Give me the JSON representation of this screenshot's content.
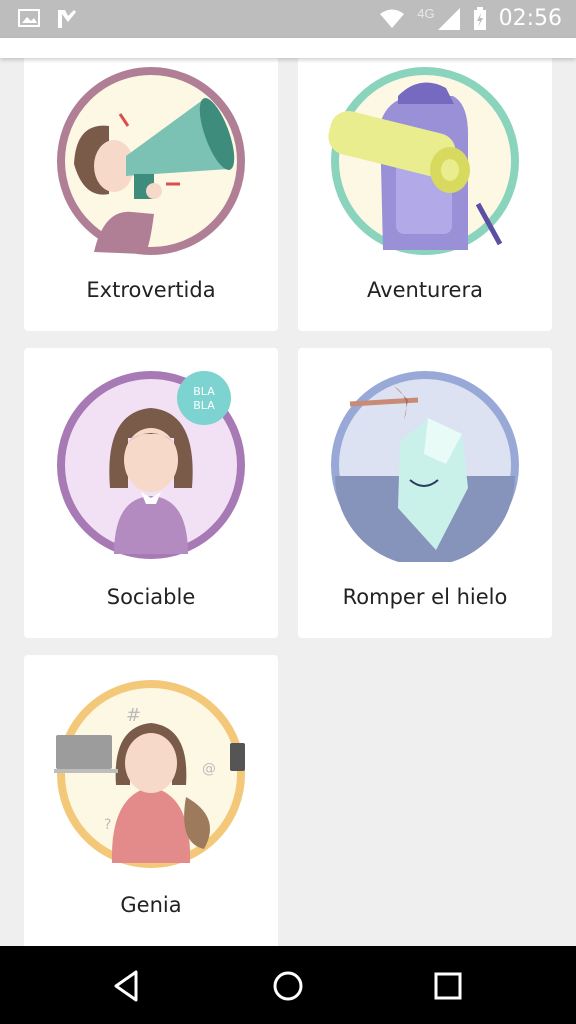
{
  "status_bar": {
    "network": "4G",
    "time": "02:56"
  },
  "badges": [
    {
      "label": "Extrovertida",
      "icon": "megaphone-icon"
    },
    {
      "label": "Aventurera",
      "icon": "backpack-icon"
    },
    {
      "label": "Sociable",
      "icon": "chat-bubble-icon",
      "bubble_text": "BLA BLA"
    },
    {
      "label": "Romper el hielo",
      "icon": "iceberg-icon"
    },
    {
      "label": "Genia",
      "icon": "laptop-icon"
    }
  ],
  "colors": {
    "status_bar": "#bdbdbd",
    "background": "#efefef",
    "card": "#ffffff",
    "nav_bar": "#000000"
  }
}
